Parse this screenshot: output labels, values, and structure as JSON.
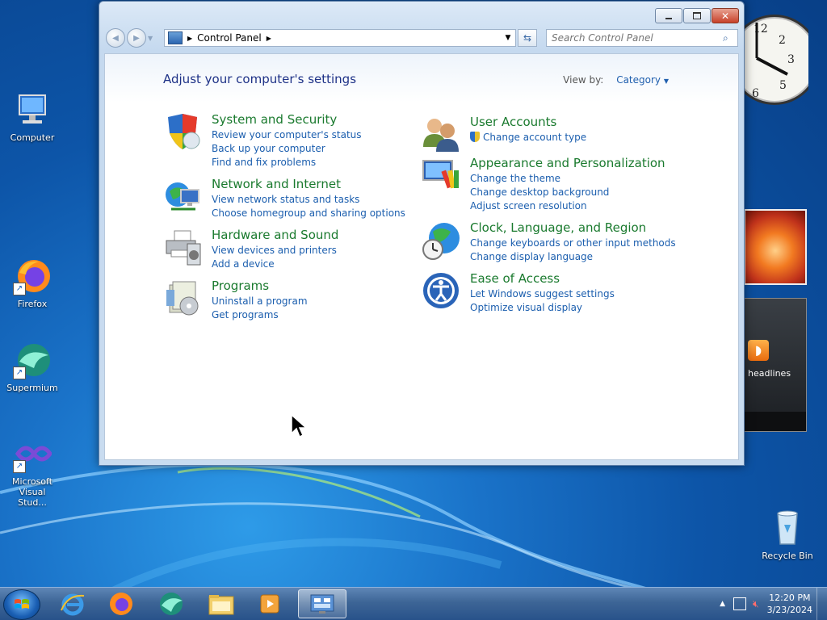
{
  "desktop": {
    "icons": [
      {
        "label": "Computer"
      },
      {
        "label": "Firefox"
      },
      {
        "label": "Supermium"
      },
      {
        "label": "Microsoft Visual Stud..."
      },
      {
        "label": "Recycle Bin"
      }
    ]
  },
  "window": {
    "breadcrumb": "Control Panel",
    "search_placeholder": "Search Control Panel",
    "heading": "Adjust your computer's settings",
    "view_by_label": "View by:",
    "view_by_value": "Category",
    "categories": [
      {
        "title": "System and Security",
        "icon": "shield-icon",
        "links": [
          "Review your computer's status",
          "Back up your computer",
          "Find and fix problems"
        ]
      },
      {
        "title": "Network and Internet",
        "icon": "network-globe-icon",
        "links": [
          "View network status and tasks",
          "Choose homegroup and sharing options"
        ]
      },
      {
        "title": "Hardware and Sound",
        "icon": "printer-icon",
        "links": [
          "View devices and printers",
          "Add a device"
        ]
      },
      {
        "title": "Programs",
        "icon": "programs-icon",
        "links": [
          "Uninstall a program",
          "Get programs"
        ]
      },
      {
        "title": "User Accounts",
        "icon": "users-icon",
        "links": [
          "Change account type"
        ]
      },
      {
        "title": "Appearance and Personalization",
        "icon": "display-palette-icon",
        "links": [
          "Change the theme",
          "Change desktop background",
          "Adjust screen resolution"
        ]
      },
      {
        "title": "Clock, Language, and Region",
        "icon": "clock-globe-icon",
        "links": [
          "Change keyboards or other input methods",
          "Change display language"
        ]
      },
      {
        "title": "Ease of Access",
        "icon": "ease-of-access-icon",
        "links": [
          "Let Windows suggest settings",
          "Optimize visual display"
        ]
      }
    ]
  },
  "gadgets": {
    "feed_label": "headlines"
  },
  "taskbar": {
    "time": "12:20 PM",
    "date": "3/23/2024",
    "items": [
      "internet-explorer-icon",
      "firefox-icon",
      "supermium-icon",
      "file-explorer-icon",
      "media-player-icon",
      "control-panel-icon"
    ]
  },
  "colors": {
    "category_title": "#1a7a2e",
    "link": "#1b5eae",
    "heading": "#1e3287"
  }
}
